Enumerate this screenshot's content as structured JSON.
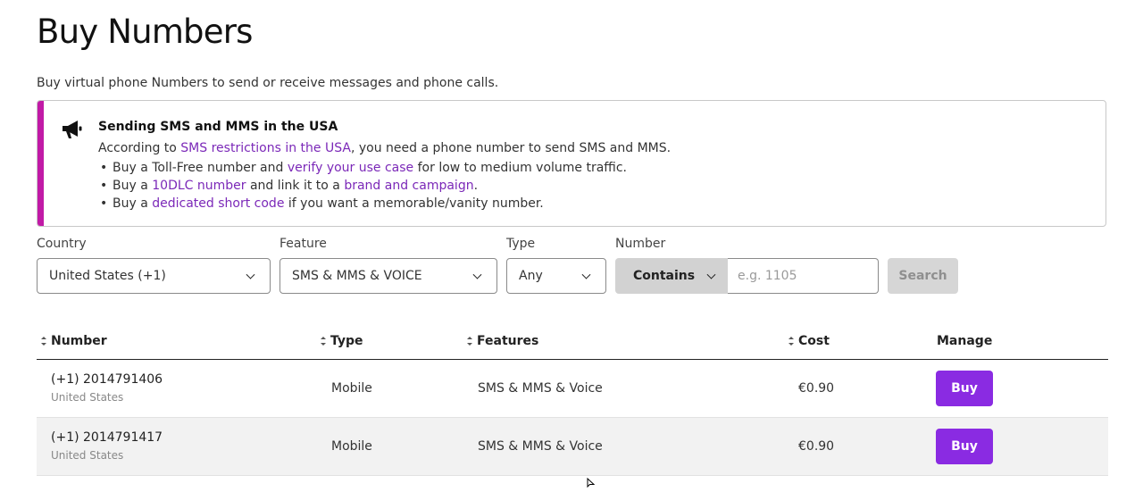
{
  "page": {
    "title": "Buy Numbers",
    "subtitle": "Buy virtual phone Numbers to send or receive messages and phone calls."
  },
  "banner": {
    "icon": "megaphone-icon",
    "accent_color": "#c11aa6",
    "title": "Sending SMS and MMS in the USA",
    "intro_prefix": "According to ",
    "intro_link": "SMS restrictions in the USA",
    "intro_suffix": ", you need a phone number to send SMS and MMS.",
    "items": [
      {
        "prefix": "Buy a Toll-Free number and ",
        "link": "verify your use case",
        "suffix": " for low to medium volume traffic."
      },
      {
        "prefix": "Buy a ",
        "link": "10DLC number",
        "middle": " and link it to a ",
        "link2": "brand and campaign",
        "suffix": "."
      },
      {
        "prefix": "Buy a ",
        "link": "dedicated short code",
        "suffix": " if you want a memorable/vanity number."
      }
    ]
  },
  "filters": {
    "country_label": "Country",
    "country_value": "United States (+1)",
    "feature_label": "Feature",
    "feature_value": "SMS & MMS & VOICE",
    "type_label": "Type",
    "type_value": "Any",
    "number_label": "Number",
    "match_value": "Contains",
    "number_placeholder": "e.g. 1105",
    "search_label": "Search"
  },
  "table": {
    "headers": {
      "number": "Number",
      "type": "Type",
      "features": "Features",
      "cost": "Cost",
      "manage": "Manage"
    },
    "rows": [
      {
        "number": "(+1) 2014791406",
        "country": "United States",
        "type": "Mobile",
        "features": "SMS & MMS & Voice",
        "cost": "€0.90",
        "action": "Buy"
      },
      {
        "number": "(+1) 2014791417",
        "country": "United States",
        "type": "Mobile",
        "features": "SMS & MMS & Voice",
        "cost": "€0.90",
        "action": "Buy"
      }
    ]
  },
  "colors": {
    "accent": "#8a2be2",
    "link": "#7b28b8"
  }
}
